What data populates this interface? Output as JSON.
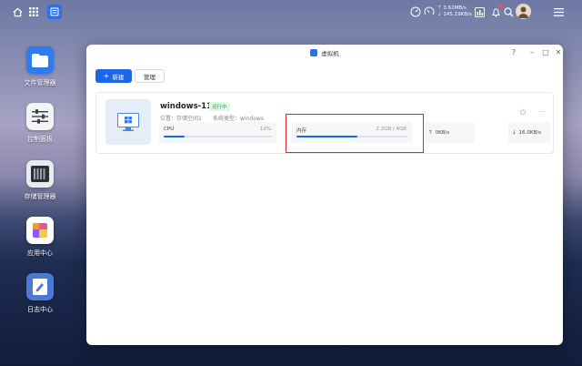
{
  "topbar": {
    "icons": [
      "home-icon",
      "apps-grid-icon",
      "app-switch-icon",
      "speed-gauge-icon",
      "upload-icon",
      "download-icon",
      "dashboard-icon",
      "bell-icon",
      "search-icon",
      "avatar",
      "menu-icon"
    ],
    "upload_speed": "⇡ 3.62MB/s",
    "download_speed": "⇣ 145.19KB/s"
  },
  "desktop": {
    "icons": [
      {
        "label": "文件管理器",
        "icon": "folder-icon",
        "color": "#2f7bf0"
      },
      {
        "label": "控制面板",
        "icon": "sliders-icon",
        "color": "#3a3f4a"
      },
      {
        "label": "存储管理器",
        "icon": "storage-icon",
        "color": "#2b2e35"
      },
      {
        "label": "应用中心",
        "icon": "app-center-icon",
        "color": "#f0a23a"
      },
      {
        "label": "日志中心",
        "icon": "log-icon",
        "color": "#4b7ad1"
      }
    ]
  },
  "window": {
    "title": "虚拟机",
    "help": "?",
    "minimize": "–",
    "maximize": "□",
    "close": "✕",
    "new_button": "新建",
    "new_plus": "+",
    "manage_button": "管理"
  },
  "vm": {
    "name": "windows-11",
    "status": "运行中",
    "location_label": "位置：",
    "location_value": "存储空间1",
    "os_label": "系统类型：",
    "os_value": "windows",
    "power": "⏻",
    "more": "···",
    "cpu_label": "CPU",
    "cpu_value": "19%",
    "cpu_fraction": 0.19,
    "mem_label": "内存",
    "mem_value": "2.2GB / 4GB",
    "mem_fraction": 0.55,
    "upload": "0KB/s",
    "upload_arrow": "↑",
    "download": "16.0KB/s",
    "download_arrow": "↓"
  },
  "colors": {
    "accent": "#1c66ea",
    "running": "#2aa54b",
    "highlight": "#d8262e"
  }
}
